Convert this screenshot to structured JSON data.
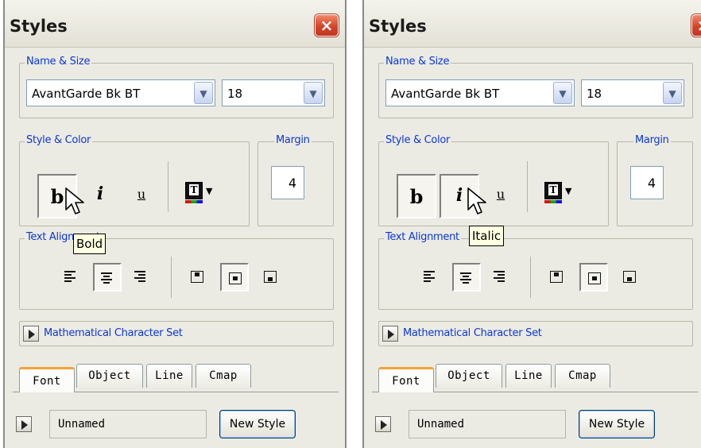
{
  "panels": [
    {
      "title": "Styles",
      "close_label": "×",
      "name_size": {
        "legend": "Name & Size",
        "font": "AvantGarde Bk BT",
        "size": "18"
      },
      "style_color": {
        "legend": "Style & Color",
        "bold": "b",
        "italic": "i",
        "underline": "u",
        "color_glyph": "T"
      },
      "margin": {
        "legend": "Margin",
        "value": "4"
      },
      "text_alignment": {
        "legend": "Text Alignment"
      },
      "math_set": "Mathematical Character Set",
      "tabs": [
        "Font",
        "Object",
        "Line",
        "Cmap"
      ],
      "style_name": "Unnamed",
      "new_style": "New Style",
      "tooltip": "Bold"
    },
    {
      "title": "Styles",
      "close_label": "×",
      "name_size": {
        "legend": "Name & Size",
        "font": "AvantGarde Bk BT",
        "size": "18"
      },
      "style_color": {
        "legend": "Style & Color",
        "bold": "b",
        "italic": "i",
        "underline": "u",
        "color_glyph": "T"
      },
      "margin": {
        "legend": "Margin",
        "value": "4"
      },
      "text_alignment": {
        "legend": "Text Alignment"
      },
      "math_set": "Mathematical Character Set",
      "tabs": [
        "Font",
        "Object",
        "Line",
        "Cmap"
      ],
      "style_name": "Unnamed",
      "new_style": "New Style",
      "tooltip": "Italic"
    }
  ],
  "colors": {
    "legend_text": "#0b38d8",
    "tooltip_bg": "#ffffe1",
    "active_tab_accent": "#f2a335",
    "close_button": "#d4452a",
    "panel_bg": "#ecebe3"
  },
  "icons": {
    "dropdown": "chevron-down-icon",
    "play": "triangle-right-icon",
    "cursor": "mouse-pointer-icon"
  }
}
